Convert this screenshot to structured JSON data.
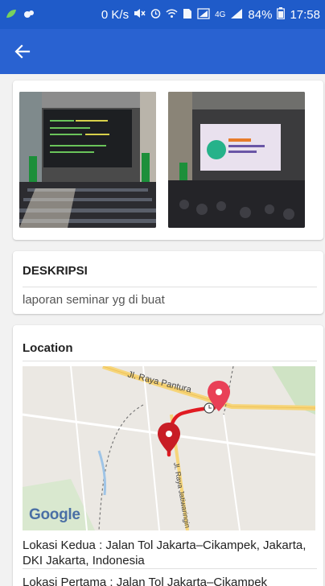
{
  "status_bar": {
    "speed": "0 K/s",
    "battery": "84%",
    "time": "17:58",
    "network": "4G"
  },
  "app_bar": {
    "back_icon": "arrow-left-icon"
  },
  "description": {
    "title": "DESKRIPSI",
    "text": "laporan seminar yg di buat"
  },
  "location": {
    "title": "Location",
    "map": {
      "road_label_1": "Jl. Raya Pantura",
      "road_label_2": "Jl. Raya Jatiwaringin",
      "logo": "Google"
    },
    "address_second": "Lokasi Kedua : Jalan Tol Jakarta–Cikampek, Jakarta, DKI Jakarta, Indonesia",
    "address_first": "Lokasi Pertama : Jalan Tol Jakarta–Cikampek"
  },
  "colors": {
    "status_bar": "#1f5bc9",
    "app_bar": "#2962d1",
    "route": "#e01b22"
  }
}
